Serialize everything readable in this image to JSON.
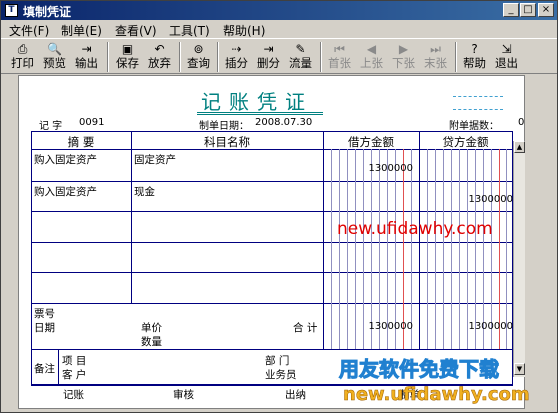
{
  "window": {
    "title": "填制凭证",
    "min": "_",
    "max": "□",
    "close": "×"
  },
  "menu": [
    "文件(F)",
    "制单(E)",
    "查看(V)",
    "工具(T)",
    "帮助(H)"
  ],
  "toolbar": [
    {
      "label": "打印",
      "icon": "printer-icon",
      "glyph": "⎙"
    },
    {
      "label": "预览",
      "icon": "preview-icon",
      "glyph": "🔍"
    },
    {
      "label": "输出",
      "icon": "export-icon",
      "glyph": "⇥"
    },
    {
      "label": "保存",
      "icon": "save-icon",
      "glyph": "▣"
    },
    {
      "label": "放弃",
      "icon": "undo-icon",
      "glyph": "↶"
    },
    {
      "label": "查询",
      "icon": "binoculars-icon",
      "glyph": "⊚"
    },
    {
      "label": "插分",
      "icon": "insert-row-icon",
      "glyph": "⇢"
    },
    {
      "label": "删分",
      "icon": "delete-row-icon",
      "glyph": "⇥"
    },
    {
      "label": "流量",
      "icon": "flow-icon",
      "glyph": "✎"
    },
    {
      "label": "首张",
      "icon": "first-icon",
      "glyph": "⏮"
    },
    {
      "label": "上张",
      "icon": "prev-icon",
      "glyph": "◀"
    },
    {
      "label": "下张",
      "icon": "next-icon",
      "glyph": "▶"
    },
    {
      "label": "末张",
      "icon": "last-icon",
      "glyph": "⏭"
    },
    {
      "label": "帮助",
      "icon": "help-icon",
      "glyph": "?"
    },
    {
      "label": "退出",
      "icon": "exit-icon",
      "glyph": "⇲"
    }
  ],
  "voucher": {
    "title": "记账凭证",
    "type_label": "记 字",
    "number": "0091",
    "date_label": "制单日期：",
    "date": "2008.07.30",
    "attachments_label": "附单据数：",
    "attachments": "0"
  },
  "columns": {
    "summary": "摘  要",
    "account": "科目名称",
    "debit": "借方金额",
    "credit": "贷方金额"
  },
  "rows": [
    {
      "summary": "购入固定资产",
      "account": "固定资产",
      "debit": "1300000",
      "credit": ""
    },
    {
      "summary": "购入固定资产",
      "account": "现金",
      "debit": "",
      "credit": "1300000"
    }
  ],
  "footer": {
    "ticket_no": "票号",
    "ticket_date": "日期",
    "unit_price": "单价",
    "quantity": "数量",
    "total_label": "合 计",
    "total_debit": "1300000",
    "total_credit": "1300000",
    "remark": "备注",
    "project": "项  目",
    "customer": "客  户",
    "department": "部  门",
    "salesperson": "业务员",
    "bookkeeper": "记账",
    "reviewer": "审核",
    "cashier": "出纳",
    "maker": "制单"
  },
  "watermarks": {
    "site": "new.ufidawhy.com",
    "banner": "用友软件免费下载",
    "site2": "new.ufidawhy.com"
  }
}
